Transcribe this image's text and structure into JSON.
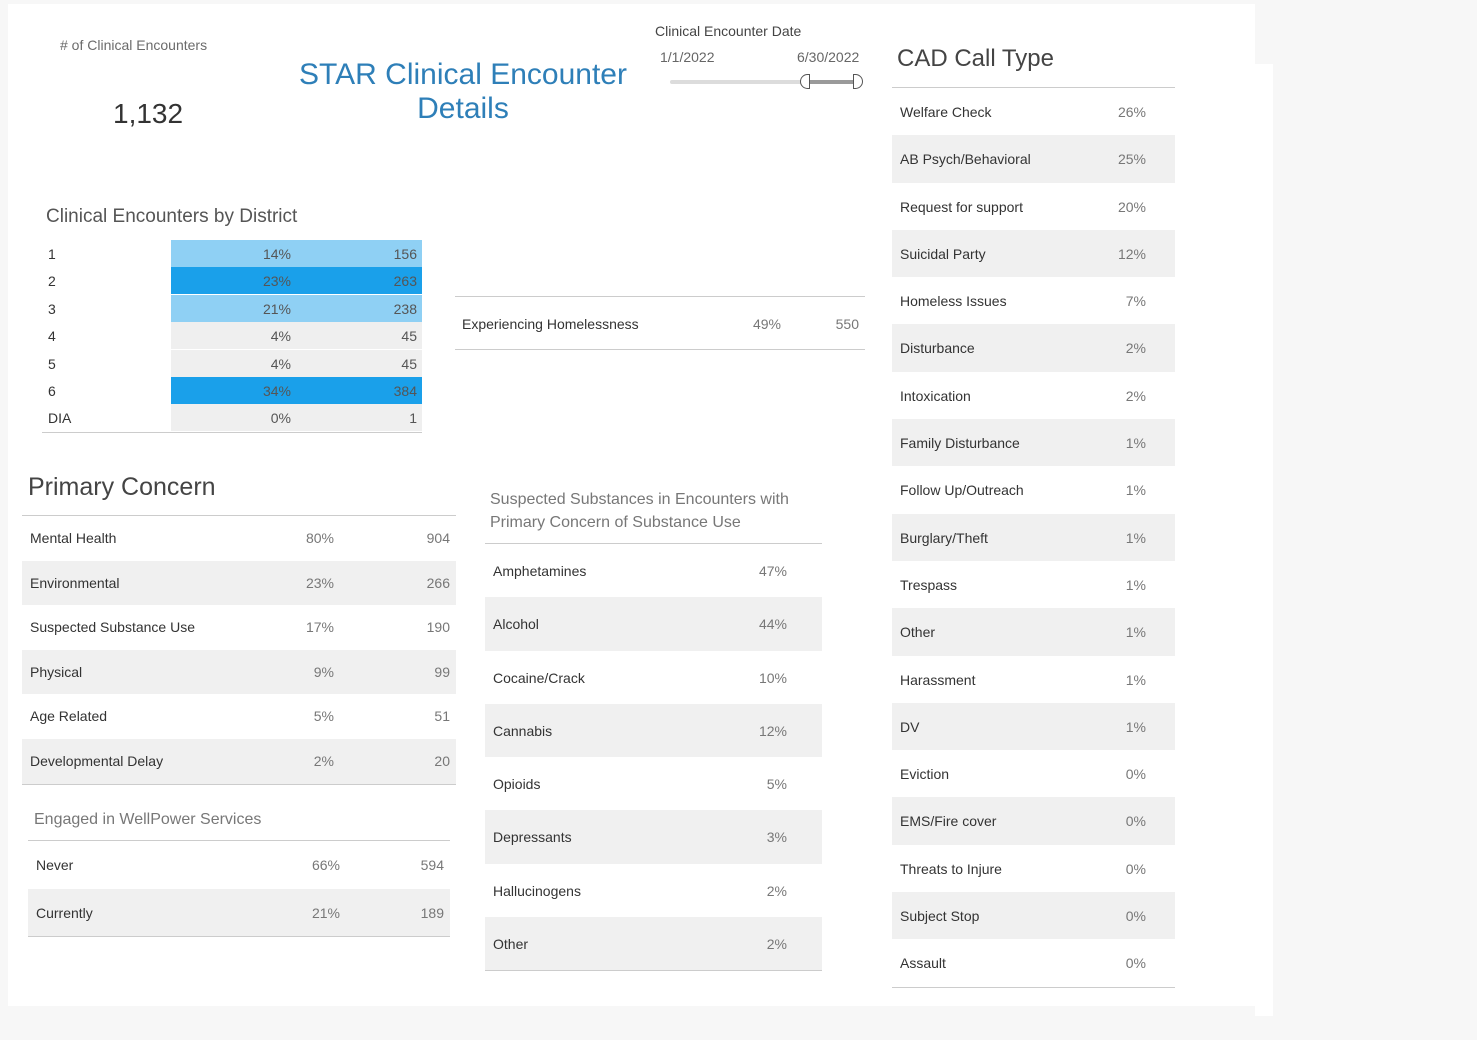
{
  "kpi": {
    "label": "# of Clinical Encounters",
    "value": "1,132"
  },
  "title": {
    "line1": "STAR Clinical Encounter",
    "line2": "Details"
  },
  "date_filter": {
    "label": "Clinical Encounter Date",
    "start": "1/1/2022",
    "end": "6/30/2022"
  },
  "colors": {
    "accent": "#2e7fb8",
    "heat_low": "#8fd0f4",
    "heat_high": "#1aa0ea",
    "neutral": "#efefef"
  },
  "district": {
    "title": "Clinical Encounters by District",
    "rows": [
      {
        "name": "1",
        "pct": "14%",
        "count": "156",
        "level": "low"
      },
      {
        "name": "2",
        "pct": "23%",
        "count": "263",
        "level": "high"
      },
      {
        "name": "3",
        "pct": "21%",
        "count": "238",
        "level": "low"
      },
      {
        "name": "4",
        "pct": "4%",
        "count": "45",
        "level": "none"
      },
      {
        "name": "5",
        "pct": "4%",
        "count": "45",
        "level": "none"
      },
      {
        "name": "6",
        "pct": "34%",
        "count": "384",
        "level": "high"
      },
      {
        "name": "DIA",
        "pct": "0%",
        "count": "1",
        "level": "none"
      }
    ]
  },
  "homelessness": {
    "label": "Experiencing Homelessness",
    "pct": "49%",
    "count": "550"
  },
  "primary_concern": {
    "title": "Primary Concern",
    "rows": [
      {
        "name": "Mental Health",
        "pct": "80%",
        "count": "904"
      },
      {
        "name": "Environmental",
        "pct": "23%",
        "count": "266"
      },
      {
        "name": "Suspected Substance Use",
        "pct": "17%",
        "count": "190"
      },
      {
        "name": "Physical",
        "pct": "9%",
        "count": "99"
      },
      {
        "name": "Age Related",
        "pct": "5%",
        "count": "51"
      },
      {
        "name": "Developmental Delay",
        "pct": "2%",
        "count": "20"
      }
    ]
  },
  "wellpower": {
    "title": "Engaged in WellPower Services",
    "rows": [
      {
        "name": "Never",
        "pct": "66%",
        "count": "594"
      },
      {
        "name": "Currently",
        "pct": "21%",
        "count": "189"
      }
    ]
  },
  "substances": {
    "title_line1": "Suspected Substances in Encounters with",
    "title_line2": "Primary Concern of Substance Use",
    "rows": [
      {
        "name": "Amphetamines",
        "pct": "47%"
      },
      {
        "name": "Alcohol",
        "pct": "44%"
      },
      {
        "name": "Cocaine/Crack",
        "pct": "10%"
      },
      {
        "name": "Cannabis",
        "pct": "12%"
      },
      {
        "name": "Opioids",
        "pct": "5%"
      },
      {
        "name": "Depressants",
        "pct": "3%"
      },
      {
        "name": "Hallucinogens",
        "pct": "2%"
      },
      {
        "name": "Other",
        "pct": "2%"
      }
    ]
  },
  "cad": {
    "title": "CAD Call Type",
    "rows": [
      {
        "name": "Welfare Check",
        "pct": "26%"
      },
      {
        "name": "AB Psych/Behavioral",
        "pct": "25%"
      },
      {
        "name": "Request for support",
        "pct": "20%"
      },
      {
        "name": "Suicidal Party",
        "pct": "12%"
      },
      {
        "name": "Homeless Issues",
        "pct": "7%"
      },
      {
        "name": "Disturbance",
        "pct": "2%"
      },
      {
        "name": "Intoxication",
        "pct": "2%"
      },
      {
        "name": "Family Disturbance",
        "pct": "1%"
      },
      {
        "name": "Follow Up/Outreach",
        "pct": "1%"
      },
      {
        "name": "Burglary/Theft",
        "pct": "1%"
      },
      {
        "name": "Trespass",
        "pct": "1%"
      },
      {
        "name": "Other",
        "pct": "1%"
      },
      {
        "name": "Harassment",
        "pct": "1%"
      },
      {
        "name": "DV",
        "pct": "1%"
      },
      {
        "name": "Eviction",
        "pct": "0%"
      },
      {
        "name": "EMS/Fire cover",
        "pct": "0%"
      },
      {
        "name": "Threats to Injure",
        "pct": "0%"
      },
      {
        "name": "Subject Stop",
        "pct": "0%"
      },
      {
        "name": "Assault",
        "pct": "0%"
      }
    ]
  }
}
